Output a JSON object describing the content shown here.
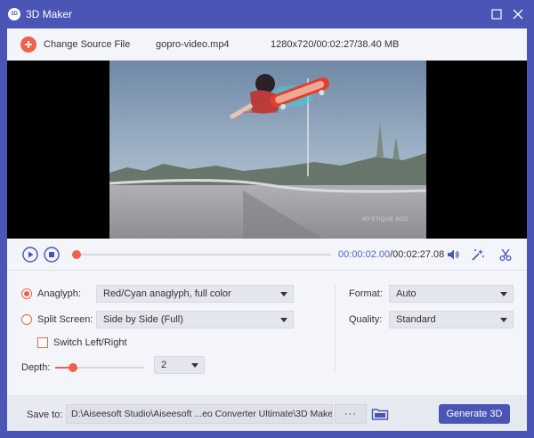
{
  "window": {
    "title": "3D Maker",
    "logo_text": "3D"
  },
  "source": {
    "change_label": "Change Source File",
    "file_name": "gopro-video.mp4",
    "file_info": "1280x720/00:02:27/38.40 MB"
  },
  "video": {
    "watermark": "MYSTIQUE NO3"
  },
  "playback": {
    "current_time": "00:00:02.00",
    "total_time": "/00:02:27.08",
    "progress_fraction": 0.0136
  },
  "settings": {
    "anaglyph_label": "Anaglyph:",
    "anaglyph_value": "Red/Cyan anaglyph, full color",
    "anaglyph_selected": true,
    "split_label": "Split Screen:",
    "split_value": "Side by Side (Full)",
    "split_selected": false,
    "switch_label": "Switch Left/Right",
    "switch_checked": false,
    "depth_label": "Depth:",
    "depth_value": "2",
    "depth_fraction": 0.2,
    "format_label": "Format:",
    "format_value": "Auto",
    "quality_label": "Quality:",
    "quality_value": "Standard"
  },
  "save": {
    "label": "Save to:",
    "path": "D:\\Aiseesoft Studio\\Aiseesoft ...eo Converter Ultimate\\3D Maker",
    "browse_label": "···",
    "generate_label": "Generate 3D"
  },
  "colors": {
    "accent": "#f0604a",
    "primary": "#4a55b5",
    "time_blue": "#4a69c9"
  },
  "icons": [
    "app-logo-icon",
    "maximize-icon",
    "close-icon",
    "plus-icon",
    "play-icon",
    "stop-icon",
    "volume-icon",
    "effect-icon",
    "scissors-icon",
    "folder-icon"
  ]
}
